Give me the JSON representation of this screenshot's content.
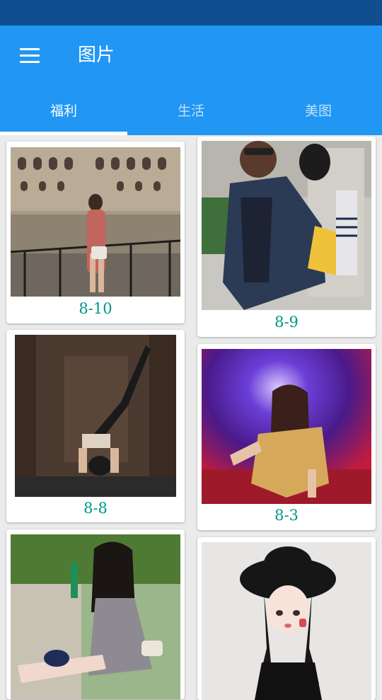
{
  "appbar": {
    "title": "图片",
    "menu_icon": "hamburger-menu-icon"
  },
  "tabs": [
    {
      "label": "福利",
      "active": true
    },
    {
      "label": "生活",
      "active": false
    },
    {
      "label": "美图",
      "active": false
    }
  ],
  "colors": {
    "status_bar": "#0f4f8f",
    "primary": "#2196f3",
    "caption_teal": "#009688",
    "background": "#ebebeb"
  },
  "cards": [
    {
      "caption": "8-10",
      "photo": "woman-at-colosseum-photo"
    },
    {
      "caption": "8-9",
      "photo": "woman-in-denim-jacket-photo"
    },
    {
      "caption": "8-8",
      "photo": "yoga-headstand-photo"
    },
    {
      "caption": "8-3",
      "photo": "woman-in-sequin-dress-photo"
    },
    {
      "caption": "",
      "photo": "woman-sitting-in-park-photo"
    },
    {
      "caption": "",
      "photo": "girl-in-black-hat-photo"
    }
  ]
}
